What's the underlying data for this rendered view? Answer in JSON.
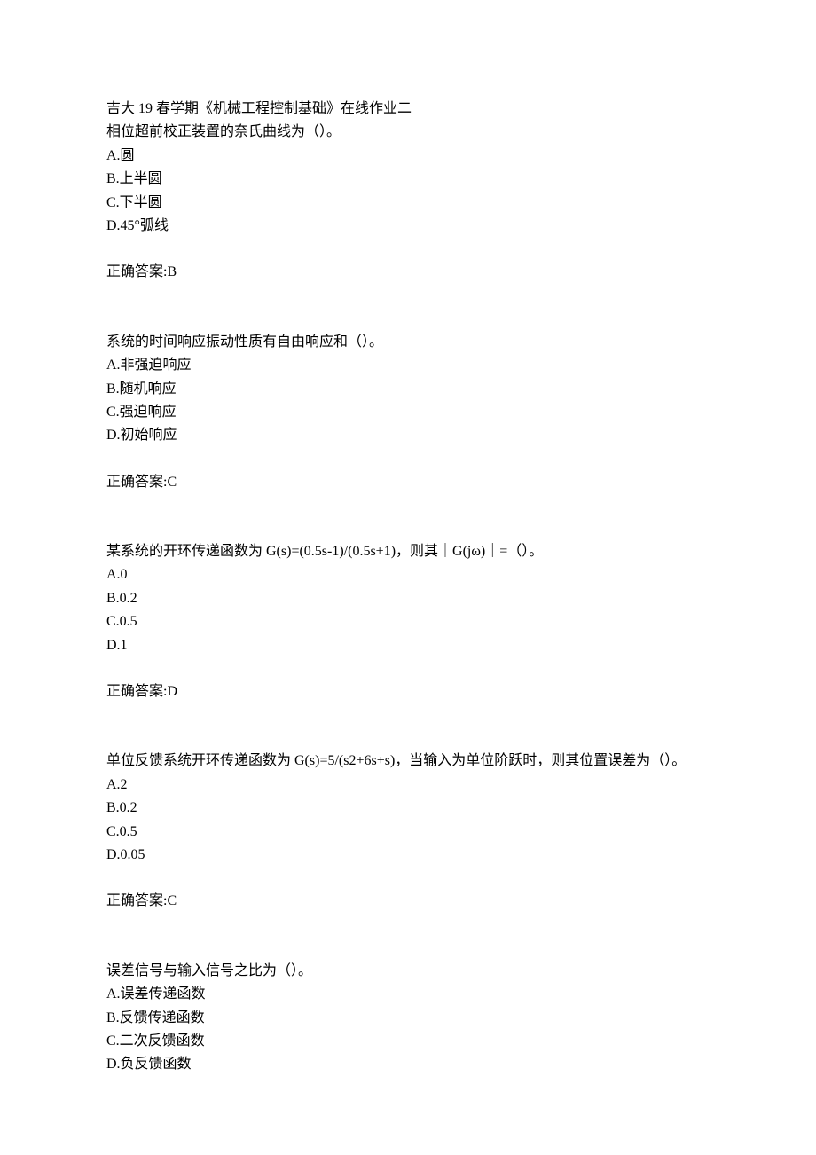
{
  "title": "吉大 19 春学期《机械工程控制基础》在线作业二",
  "questions": [
    {
      "question": "相位超前校正装置的奈氏曲线为（）。",
      "options": [
        "A.圆",
        "B.上半圆",
        "C.下半圆",
        "D.45°弧线"
      ],
      "answer": "正确答案:B"
    },
    {
      "question": "系统的时间响应振动性质有自由响应和（）。",
      "options": [
        "A.非强迫响应",
        "B.随机响应",
        "C.强迫响应",
        "D.初始响应"
      ],
      "answer": "正确答案:C"
    },
    {
      "question": "某系统的开环传递函数为 G(s)=(0.5s-1)/(0.5s+1)，则其｜G(jω)｜=（）。",
      "options": [
        "A.0",
        "B.0.2",
        "C.0.5",
        "D.1"
      ],
      "answer": "正确答案:D"
    },
    {
      "question": "单位反馈系统开环传递函数为 G(s)=5/(s2+6s+s)，当输入为单位阶跃时，则其位置误差为（）。",
      "options": [
        "A.2",
        "B.0.2",
        "C.0.5",
        "D.0.05"
      ],
      "answer": "正确答案:C"
    },
    {
      "question": "误差信号与输入信号之比为（）。",
      "options": [
        "A.误差传递函数",
        "B.反馈传递函数",
        "C.二次反馈函数",
        "D.负反馈函数"
      ],
      "answer": ""
    }
  ]
}
